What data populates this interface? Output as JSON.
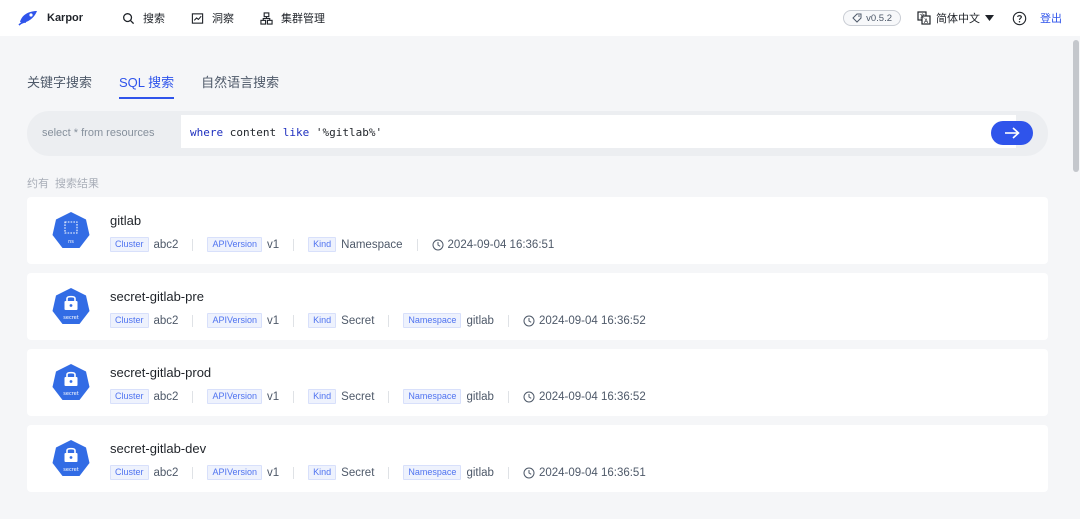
{
  "header": {
    "brand_name": "Karpor",
    "nav": [
      {
        "label": "搜索",
        "icon": "search-icon"
      },
      {
        "label": "洞察",
        "icon": "chart-icon"
      },
      {
        "label": "集群管理",
        "icon": "cluster-icon"
      }
    ],
    "version": "v0.5.2",
    "language": "简体中文",
    "logout_label": "登出"
  },
  "tabs": [
    {
      "label": "关键字搜索",
      "active": false
    },
    {
      "label": "SQL 搜索",
      "active": true
    },
    {
      "label": "自然语言搜索",
      "active": false
    }
  ],
  "search": {
    "prefix": "select * from resources",
    "query_parts": [
      "where",
      " content ",
      "like",
      " '%gitlab%'"
    ]
  },
  "summary": {
    "prefix": "约有",
    "suffix": "搜索结果"
  },
  "results": [
    {
      "name": "gitlab",
      "icon_label": "ns",
      "cluster_key": "Cluster",
      "cluster": "abc2",
      "api_key": "APIVersion",
      "api": "v1",
      "kind_key": "Kind",
      "kind": "Namespace",
      "namespace_key": "",
      "namespace": "",
      "time": "2024-09-04 16:36:51"
    },
    {
      "name": "secret-gitlab-pre",
      "icon_label": "secret",
      "cluster_key": "Cluster",
      "cluster": "abc2",
      "api_key": "APIVersion",
      "api": "v1",
      "kind_key": "Kind",
      "kind": "Secret",
      "namespace_key": "Namespace",
      "namespace": "gitlab",
      "time": "2024-09-04 16:36:52"
    },
    {
      "name": "secret-gitlab-prod",
      "icon_label": "secret",
      "cluster_key": "Cluster",
      "cluster": "abc2",
      "api_key": "APIVersion",
      "api": "v1",
      "kind_key": "Kind",
      "kind": "Secret",
      "namespace_key": "Namespace",
      "namespace": "gitlab",
      "time": "2024-09-04 16:36:52"
    },
    {
      "name": "secret-gitlab-dev",
      "icon_label": "secret",
      "cluster_key": "Cluster",
      "cluster": "abc2",
      "api_key": "APIVersion",
      "api": "v1",
      "kind_key": "Kind",
      "kind": "Secret",
      "namespace_key": "Namespace",
      "namespace": "gitlab",
      "time": "2024-09-04 16:36:51"
    }
  ],
  "colors": {
    "accent": "#2f54eb",
    "k8s_blue": "#326ce5",
    "background": "#f5f6f8"
  }
}
